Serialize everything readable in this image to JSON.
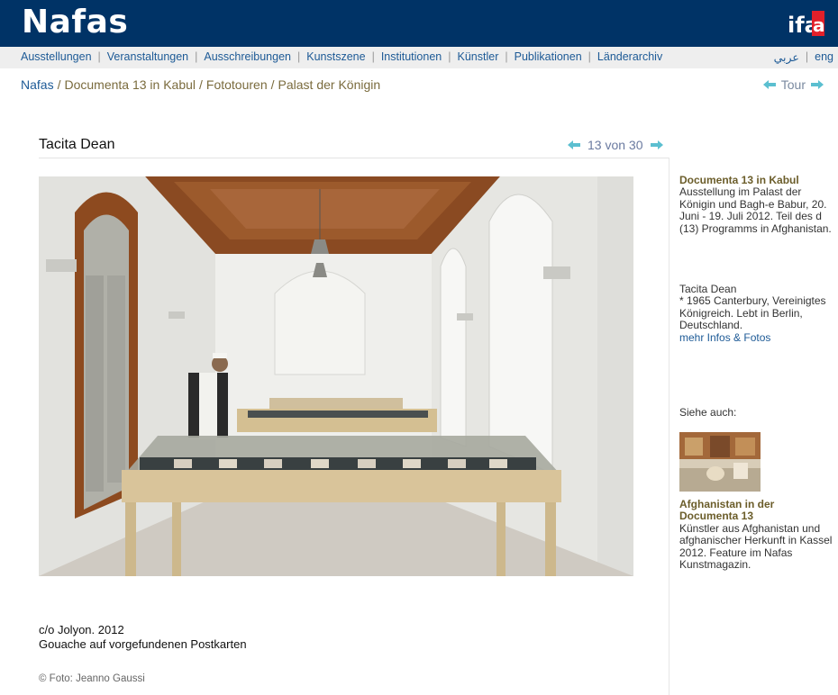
{
  "header": {
    "logo": "Nafas",
    "partner_logo": "ifa"
  },
  "nav": {
    "items": [
      "Ausstellungen",
      "Veranstaltungen",
      "Ausschreibungen",
      "Kunstszene",
      "Institutionen",
      "Künstler",
      "Publikationen",
      "Länderarchiv"
    ],
    "lang": [
      "عربي",
      "eng"
    ]
  },
  "breadcrumb": {
    "items": [
      "Nafas",
      "Documenta 13 in Kabul",
      "Fototouren",
      "Palast der Königin"
    ]
  },
  "tour": {
    "label": "Tour"
  },
  "gallery": {
    "title": "Tacita Dean",
    "counter": "13 von 30"
  },
  "caption": {
    "line1": "c/o Jolyon. 2012",
    "line2": "Gouache auf vorgefundenen Postkarten",
    "credit": "© Foto: Jeanno Gaussi"
  },
  "sidebar": {
    "exhibition_title": "Documenta 13 in Kabul",
    "exhibition_text": "Ausstellung im Palast der Königin und Bagh-e Babur, 20. Juni - 19. Juli 2012. Teil des d (13) Programms in Afghanistan.",
    "artist_name": "Tacita Dean",
    "artist_bio": "* 1965 Canterbury, Vereinigtes Königreich. Lebt in Berlin, Deutschland.",
    "artist_link": "mehr Infos & Fotos",
    "see_also_label": "Siehe auch:",
    "related_title": "Afghanistan in der Documenta 13",
    "related_text": "Künstler aus Afghanistan und afghanischer Herkunft in Kassel 2012. Feature im Nafas Kunstmagazin."
  },
  "colors": {
    "header_bg": "#003366",
    "nav_bg": "#eeeeee",
    "link": "#1d5a96",
    "olive": "#7a6b3d",
    "arrow": "#5bbfd0",
    "ifa_red": "#e3202a"
  }
}
